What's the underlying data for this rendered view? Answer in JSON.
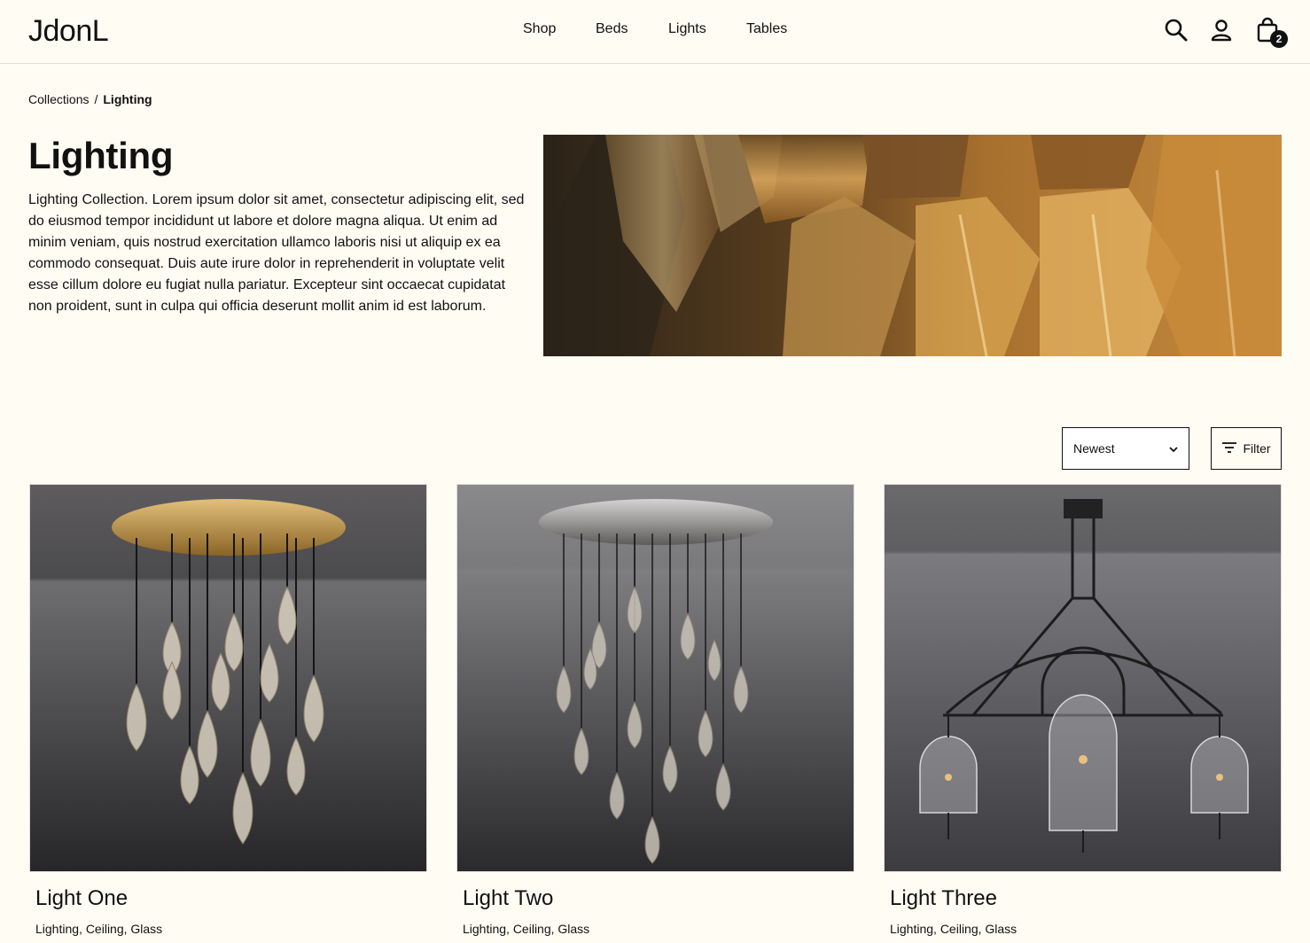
{
  "header": {
    "logo": "JdonL",
    "nav": [
      {
        "label": "Shop"
      },
      {
        "label": "Beds"
      },
      {
        "label": "Lights"
      },
      {
        "label": "Tables"
      }
    ],
    "icons": [
      "search-icon",
      "account-icon",
      "cart-icon"
    ],
    "cart_count": "2"
  },
  "breadcrumb": {
    "parent": "Collections",
    "separator": "/",
    "current": "Lighting"
  },
  "collection": {
    "title": "Lighting",
    "description": "Lighting Collection. Lorem ipsum dolor sit amet, consectetur adipiscing elit, sed do eiusmod tempor incididunt ut labore et dolore magna aliqua. Ut enim ad minim veniam, quis nostrud exercitation ullamco laboris nisi ut aliquip ex ea commodo consequat. Duis aute irure dolor in reprehenderit in voluptate velit esse cillum dolore eu fugiat nulla pariatur. Excepteur sint occaecat cupidatat non proident, sunt in culpa qui officia deserunt mollit anim id est laborum."
  },
  "toolbar": {
    "sort_selected": "Newest",
    "filter_label": "Filter"
  },
  "products": [
    {
      "name": "Light One",
      "tags": "Lighting, Ceiling, Glass"
    },
    {
      "name": "Light Two",
      "tags": "Lighting, Ceiling, Glass"
    },
    {
      "name": "Light Three",
      "tags": "Lighting, Ceiling, Glass"
    }
  ],
  "colors": {
    "background": "#fffcf4",
    "text": "#111111",
    "hero_amber": "#b8782a"
  }
}
